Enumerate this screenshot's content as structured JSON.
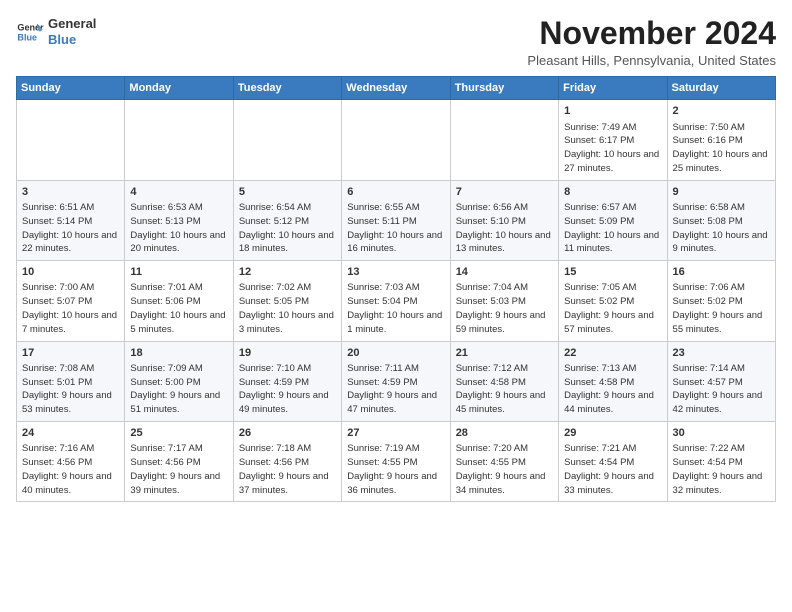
{
  "header": {
    "logo_line1": "General",
    "logo_line2": "Blue",
    "month_title": "November 2024",
    "location": "Pleasant Hills, Pennsylvania, United States"
  },
  "weekdays": [
    "Sunday",
    "Monday",
    "Tuesday",
    "Wednesday",
    "Thursday",
    "Friday",
    "Saturday"
  ],
  "weeks": [
    [
      {
        "day": "",
        "info": ""
      },
      {
        "day": "",
        "info": ""
      },
      {
        "day": "",
        "info": ""
      },
      {
        "day": "",
        "info": ""
      },
      {
        "day": "",
        "info": ""
      },
      {
        "day": "1",
        "info": "Sunrise: 7:49 AM\nSunset: 6:17 PM\nDaylight: 10 hours and 27 minutes."
      },
      {
        "day": "2",
        "info": "Sunrise: 7:50 AM\nSunset: 6:16 PM\nDaylight: 10 hours and 25 minutes."
      }
    ],
    [
      {
        "day": "3",
        "info": "Sunrise: 6:51 AM\nSunset: 5:14 PM\nDaylight: 10 hours and 22 minutes."
      },
      {
        "day": "4",
        "info": "Sunrise: 6:53 AM\nSunset: 5:13 PM\nDaylight: 10 hours and 20 minutes."
      },
      {
        "day": "5",
        "info": "Sunrise: 6:54 AM\nSunset: 5:12 PM\nDaylight: 10 hours and 18 minutes."
      },
      {
        "day": "6",
        "info": "Sunrise: 6:55 AM\nSunset: 5:11 PM\nDaylight: 10 hours and 16 minutes."
      },
      {
        "day": "7",
        "info": "Sunrise: 6:56 AM\nSunset: 5:10 PM\nDaylight: 10 hours and 13 minutes."
      },
      {
        "day": "8",
        "info": "Sunrise: 6:57 AM\nSunset: 5:09 PM\nDaylight: 10 hours and 11 minutes."
      },
      {
        "day": "9",
        "info": "Sunrise: 6:58 AM\nSunset: 5:08 PM\nDaylight: 10 hours and 9 minutes."
      }
    ],
    [
      {
        "day": "10",
        "info": "Sunrise: 7:00 AM\nSunset: 5:07 PM\nDaylight: 10 hours and 7 minutes."
      },
      {
        "day": "11",
        "info": "Sunrise: 7:01 AM\nSunset: 5:06 PM\nDaylight: 10 hours and 5 minutes."
      },
      {
        "day": "12",
        "info": "Sunrise: 7:02 AM\nSunset: 5:05 PM\nDaylight: 10 hours and 3 minutes."
      },
      {
        "day": "13",
        "info": "Sunrise: 7:03 AM\nSunset: 5:04 PM\nDaylight: 10 hours and 1 minute."
      },
      {
        "day": "14",
        "info": "Sunrise: 7:04 AM\nSunset: 5:03 PM\nDaylight: 9 hours and 59 minutes."
      },
      {
        "day": "15",
        "info": "Sunrise: 7:05 AM\nSunset: 5:02 PM\nDaylight: 9 hours and 57 minutes."
      },
      {
        "day": "16",
        "info": "Sunrise: 7:06 AM\nSunset: 5:02 PM\nDaylight: 9 hours and 55 minutes."
      }
    ],
    [
      {
        "day": "17",
        "info": "Sunrise: 7:08 AM\nSunset: 5:01 PM\nDaylight: 9 hours and 53 minutes."
      },
      {
        "day": "18",
        "info": "Sunrise: 7:09 AM\nSunset: 5:00 PM\nDaylight: 9 hours and 51 minutes."
      },
      {
        "day": "19",
        "info": "Sunrise: 7:10 AM\nSunset: 4:59 PM\nDaylight: 9 hours and 49 minutes."
      },
      {
        "day": "20",
        "info": "Sunrise: 7:11 AM\nSunset: 4:59 PM\nDaylight: 9 hours and 47 minutes."
      },
      {
        "day": "21",
        "info": "Sunrise: 7:12 AM\nSunset: 4:58 PM\nDaylight: 9 hours and 45 minutes."
      },
      {
        "day": "22",
        "info": "Sunrise: 7:13 AM\nSunset: 4:58 PM\nDaylight: 9 hours and 44 minutes."
      },
      {
        "day": "23",
        "info": "Sunrise: 7:14 AM\nSunset: 4:57 PM\nDaylight: 9 hours and 42 minutes."
      }
    ],
    [
      {
        "day": "24",
        "info": "Sunrise: 7:16 AM\nSunset: 4:56 PM\nDaylight: 9 hours and 40 minutes."
      },
      {
        "day": "25",
        "info": "Sunrise: 7:17 AM\nSunset: 4:56 PM\nDaylight: 9 hours and 39 minutes."
      },
      {
        "day": "26",
        "info": "Sunrise: 7:18 AM\nSunset: 4:56 PM\nDaylight: 9 hours and 37 minutes."
      },
      {
        "day": "27",
        "info": "Sunrise: 7:19 AM\nSunset: 4:55 PM\nDaylight: 9 hours and 36 minutes."
      },
      {
        "day": "28",
        "info": "Sunrise: 7:20 AM\nSunset: 4:55 PM\nDaylight: 9 hours and 34 minutes."
      },
      {
        "day": "29",
        "info": "Sunrise: 7:21 AM\nSunset: 4:54 PM\nDaylight: 9 hours and 33 minutes."
      },
      {
        "day": "30",
        "info": "Sunrise: 7:22 AM\nSunset: 4:54 PM\nDaylight: 9 hours and 32 minutes."
      }
    ]
  ]
}
